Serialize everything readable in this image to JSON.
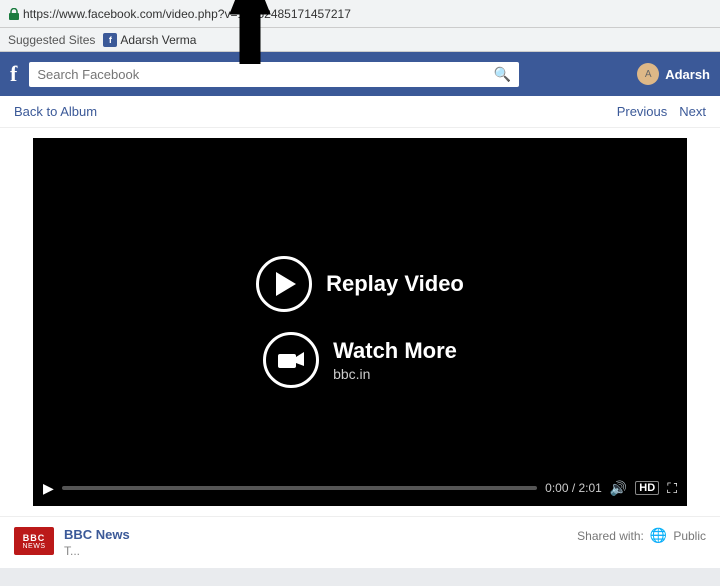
{
  "browser": {
    "url": "https://www.facebook.com/video.php?v=10152485171457217",
    "ssl_label": "https://www.facebook.com/video.php?v=10152485171457217",
    "bookmarks": {
      "suggested": "Suggested Sites",
      "user": "Adarsh Verma"
    }
  },
  "nav": {
    "fb_logo": "f",
    "search_placeholder": "Search Facebook",
    "username": "Adarsh"
  },
  "page": {
    "back_to_album": "Back to Album",
    "previous": "Previous",
    "next": "Next",
    "video": {
      "replay_label": "Replay Video",
      "watch_more_label": "Watch More",
      "watch_more_sub": "bbc.in",
      "time": "0:00 / 2:01",
      "hd": "HD"
    },
    "footer": {
      "channel": "BBC News",
      "description": "T...",
      "shared_label": "Shared with:",
      "visibility": "Public"
    }
  }
}
